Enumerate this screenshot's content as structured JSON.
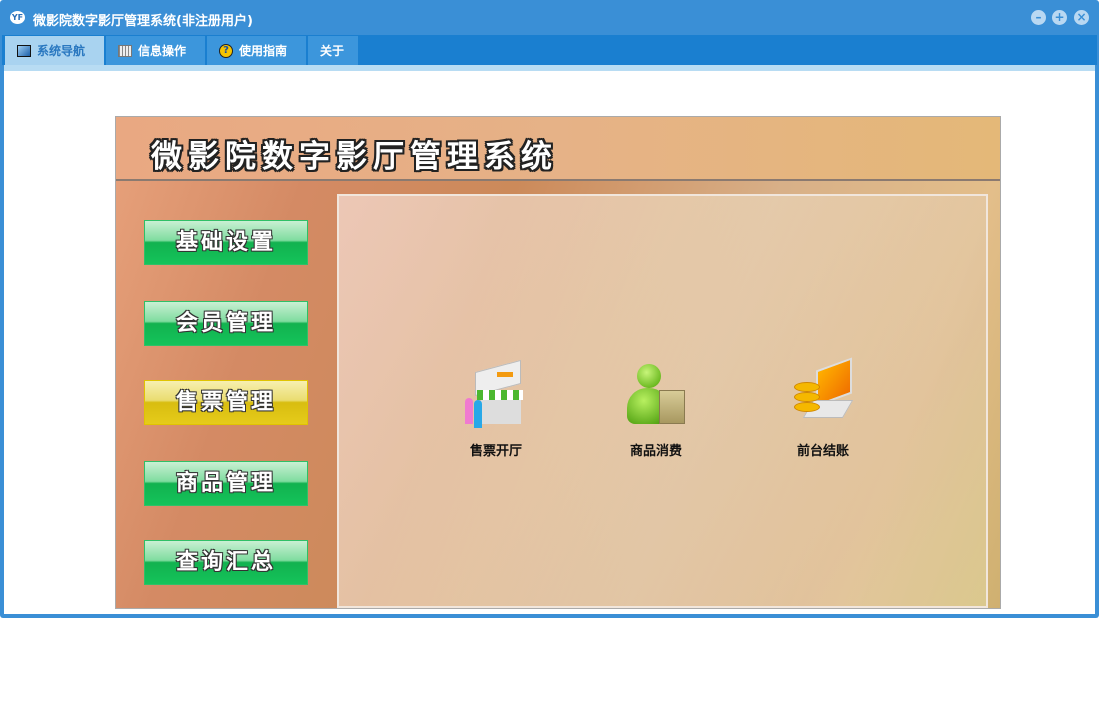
{
  "window": {
    "title": "微影院数字影厅管理系统(非注册用户)",
    "app_icon": "YF",
    "controls": [
      "minimize",
      "restore",
      "close"
    ]
  },
  "tabs": [
    {
      "label": "系统导航",
      "icon": "monitor-icon",
      "active": true
    },
    {
      "label": "信息操作",
      "icon": "grid-icon"
    },
    {
      "label": "使用指南",
      "icon": "help-icon"
    },
    {
      "label": "关于"
    }
  ],
  "system_title": "微影院数字影厅管理系统",
  "nav": [
    {
      "label": "基础设置"
    },
    {
      "label": "会员管理"
    },
    {
      "label": "售票管理",
      "active": true
    },
    {
      "label": "商品管理"
    },
    {
      "label": "查询汇总"
    }
  ],
  "functions": [
    {
      "label": "售票开厅",
      "icon": "ticket-booth-icon"
    },
    {
      "label": "商品消费",
      "icon": "shopping-user-icon"
    },
    {
      "label": "前台结账",
      "icon": "checkout-laptop-icon"
    }
  ]
}
